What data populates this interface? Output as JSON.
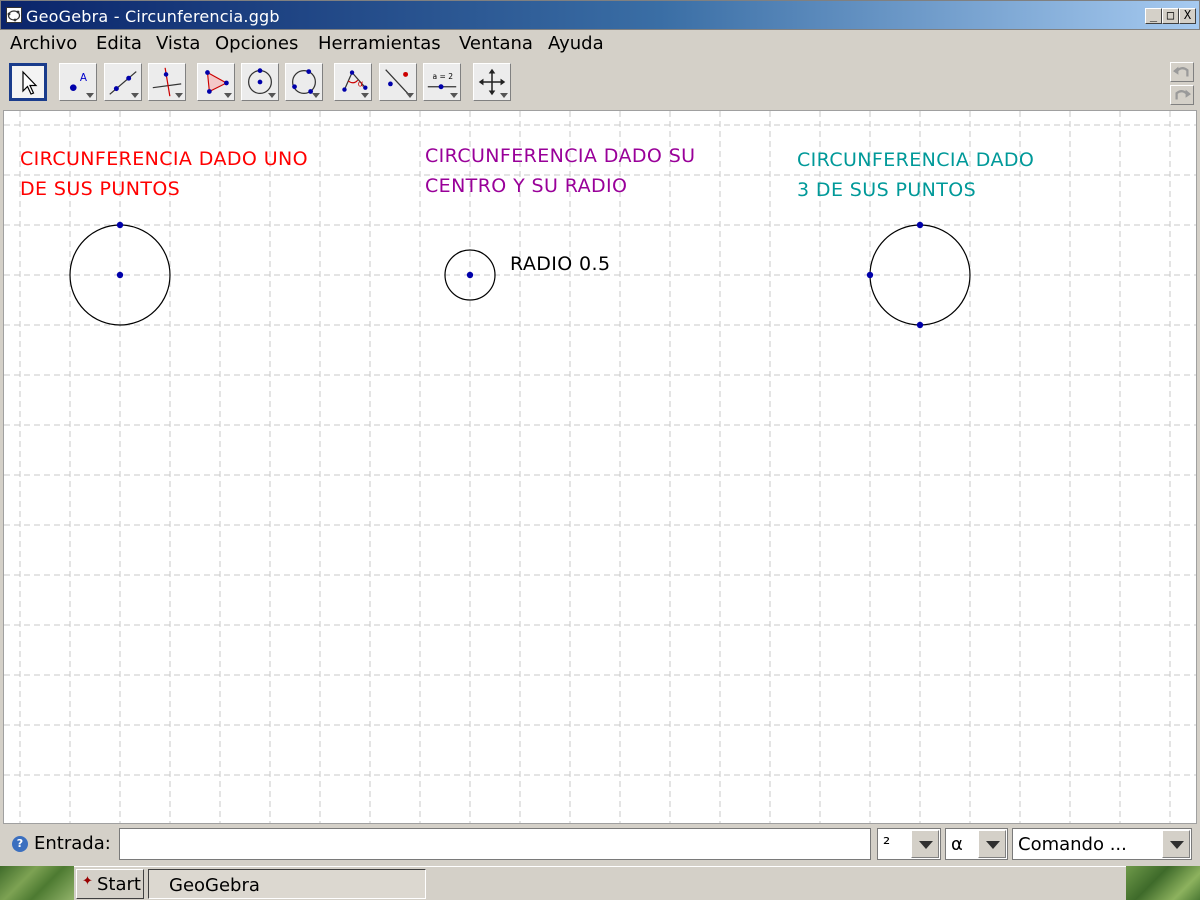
{
  "window": {
    "title": "GeoGebra - Circunferencia.ggb",
    "buttons": {
      "minimize": "_",
      "maximize": "□",
      "close": "X"
    }
  },
  "menu": {
    "items": [
      "Archivo",
      "Edita",
      "Vista",
      "Opciones",
      "Herramientas",
      "Ventana",
      "Ayuda"
    ]
  },
  "toolbar": {
    "tools": [
      {
        "icon": "move-pointer-icon",
        "selected": true
      },
      {
        "icon": "new-point-icon",
        "text": "A"
      },
      {
        "icon": "line-through-two-points-icon"
      },
      {
        "icon": "perpendicular-line-icon"
      },
      {
        "icon": "polygon-icon"
      },
      {
        "icon": "circle-center-point-icon"
      },
      {
        "icon": "circle-three-points-icon"
      },
      {
        "icon": "angle-icon",
        "text": "α"
      },
      {
        "icon": "reflect-about-line-icon"
      },
      {
        "icon": "slider-icon",
        "text": "a = 2"
      },
      {
        "icon": "move-graphics-view-icon"
      }
    ],
    "undo_icon": "undo-icon",
    "redo_icon": "redo-icon"
  },
  "graphics": {
    "labels": [
      {
        "lines": [
          "CIRCUNFERENCIA DADO UNO",
          "DE SUS PUNTOS"
        ],
        "color": "#ff0000"
      },
      {
        "lines": [
          "CIRCUNFERENCIA DADO SU",
          "CENTRO Y SU RADIO"
        ],
        "color": "#990099"
      },
      {
        "lines": [
          "CIRCUNFERENCIA DADO",
          "3 DE SUS PUNTOS"
        ],
        "color": "#009999"
      }
    ],
    "radio_label": "RADIO 0.5",
    "colors": {
      "point": "#0000aa",
      "circle": "#000000",
      "grid": "#c8c8c8"
    }
  },
  "input_bar": {
    "label": "Entrada:",
    "value": "",
    "superscript_select": "²",
    "greek_select": "α",
    "command_select": "Comando ..."
  },
  "taskbar": {
    "start_label": "Start",
    "task_label": "GeoGebra"
  }
}
